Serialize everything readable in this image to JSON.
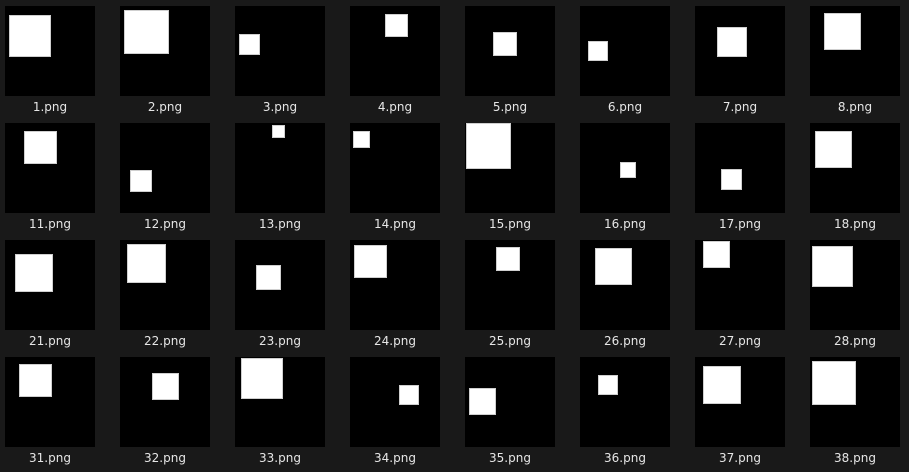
{
  "window": {
    "view": "large-icons",
    "background_color": "#191919",
    "thumbnail_background": "#000000",
    "shape_color": "#ffffff",
    "label_color": "#e6e6e6"
  },
  "files": [
    {
      "name": "1.png",
      "icon": "image-thumbnail-icon"
    },
    {
      "name": "2.png",
      "icon": "image-thumbnail-icon"
    },
    {
      "name": "3.png",
      "icon": "image-thumbnail-icon"
    },
    {
      "name": "4.png",
      "icon": "image-thumbnail-icon"
    },
    {
      "name": "5.png",
      "icon": "image-thumbnail-icon"
    },
    {
      "name": "6.png",
      "icon": "image-thumbnail-icon"
    },
    {
      "name": "7.png",
      "icon": "image-thumbnail-icon"
    },
    {
      "name": "8.png",
      "icon": "image-thumbnail-icon"
    },
    {
      "name": "11.png",
      "icon": "image-thumbnail-icon"
    },
    {
      "name": "12.png",
      "icon": "image-thumbnail-icon"
    },
    {
      "name": "13.png",
      "icon": "image-thumbnail-icon"
    },
    {
      "name": "14.png",
      "icon": "image-thumbnail-icon"
    },
    {
      "name": "15.png",
      "icon": "image-thumbnail-icon"
    },
    {
      "name": "16.png",
      "icon": "image-thumbnail-icon"
    },
    {
      "name": "17.png",
      "icon": "image-thumbnail-icon"
    },
    {
      "name": "18.png",
      "icon": "image-thumbnail-icon"
    },
    {
      "name": "21.png",
      "icon": "image-thumbnail-icon"
    },
    {
      "name": "22.png",
      "icon": "image-thumbnail-icon"
    },
    {
      "name": "23.png",
      "icon": "image-thumbnail-icon"
    },
    {
      "name": "24.png",
      "icon": "image-thumbnail-icon"
    },
    {
      "name": "25.png",
      "icon": "image-thumbnail-icon"
    },
    {
      "name": "26.png",
      "icon": "image-thumbnail-icon"
    },
    {
      "name": "27.png",
      "icon": "image-thumbnail-icon"
    },
    {
      "name": "28.png",
      "icon": "image-thumbnail-icon"
    },
    {
      "name": "31.png",
      "icon": "image-thumbnail-icon"
    },
    {
      "name": "32.png",
      "icon": "image-thumbnail-icon"
    },
    {
      "name": "33.png",
      "icon": "image-thumbnail-icon"
    },
    {
      "name": "34.png",
      "icon": "image-thumbnail-icon"
    },
    {
      "name": "35.png",
      "icon": "image-thumbnail-icon"
    },
    {
      "name": "36.png",
      "icon": "image-thumbnail-icon"
    },
    {
      "name": "37.png",
      "icon": "image-thumbnail-icon"
    },
    {
      "name": "38.png",
      "icon": "image-thumbnail-icon"
    }
  ]
}
